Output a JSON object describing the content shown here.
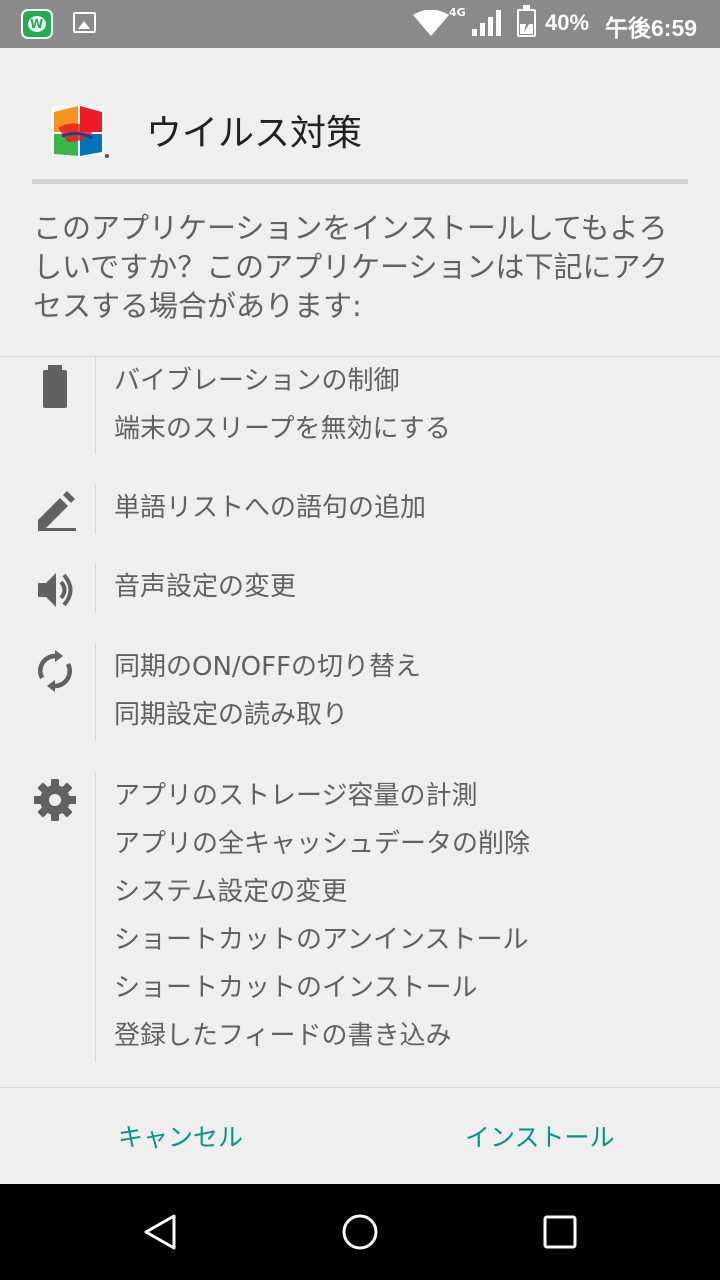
{
  "status_bar": {
    "network": "4G",
    "battery_percent": "40%",
    "battery_level": 0.4,
    "time": "午後6:59",
    "icons": [
      "app-notification-icon",
      "image-icon",
      "wifi-icon",
      "signal-icon",
      "battery-charging-icon"
    ]
  },
  "app": {
    "title": "ウイルス対策",
    "logo": "avg-logo"
  },
  "prompt": {
    "question": "このアプリケーションをインストールしてもよろしいですか？このアプリケーションは下記にアクセスする場合があります:"
  },
  "permissions": [
    {
      "icon": "battery-icon",
      "items": [
        "バイブレーションの制御",
        "端末のスリープを無効にする"
      ]
    },
    {
      "icon": "pen-icon",
      "items": [
        "単語リストへの語句の追加"
      ]
    },
    {
      "icon": "volume-icon",
      "items": [
        "音声設定の変更"
      ]
    },
    {
      "icon": "sync-icon",
      "items": [
        "同期のON/OFFの切り替え",
        "同期設定の読み取り"
      ]
    },
    {
      "icon": "gear-icon",
      "items": [
        "アプリのストレージ容量の計測",
        "アプリの全キャッシュデータの削除",
        "システム設定の変更",
        "ショートカットのアンインストール",
        "ショートカットのインストール",
        "登録したフィードの書き込み"
      ]
    }
  ],
  "buttons": {
    "cancel": "キャンセル",
    "install": "インストール"
  },
  "nav": {
    "icons": [
      "back-icon",
      "home-icon",
      "recent-apps-icon"
    ]
  },
  "colors": {
    "accent": "#009688",
    "status_bar": "#8a8a8a",
    "background": "#efefef",
    "nav_bar": "#000000"
  }
}
